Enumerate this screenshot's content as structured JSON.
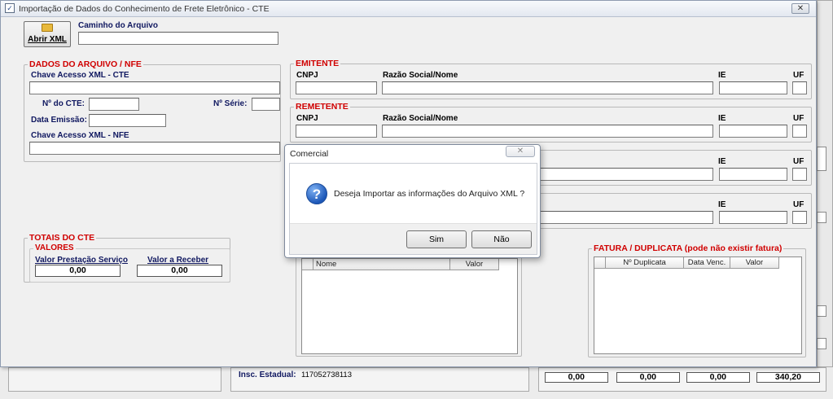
{
  "window": {
    "title": "Importação de Dados do Conhecimento de Frete Eletrônico - CTE",
    "close_label": "✕"
  },
  "toolbar": {
    "open_xml_label": "Abrir XML",
    "file_path_label": "Caminho do Arquivo",
    "file_path_value": ""
  },
  "arquivo": {
    "title": "DADOS DO ARQUIVO / NFE",
    "chave_cte_label": "Chave Acesso XML - CTE",
    "num_cte_label": "Nº do CTE:",
    "num_serie_label": "Nº Série:",
    "data_emissao_label": "Data Emissão:",
    "chave_nfe_label": "Chave Acesso XML - NFE"
  },
  "emitente": {
    "title": "EMITENTE",
    "cnpj_label": "CNPJ",
    "razao_label": "Razão Social/Nome",
    "ie_label": "IE",
    "uf_label": "UF"
  },
  "remetente": {
    "title": "REMETENTE",
    "cnpj_label": "CNPJ",
    "razao_label": "Razão Social/Nome",
    "ie_label": "IE",
    "uf_label": "UF"
  },
  "row3": {
    "ie_label": "IE",
    "uf_label": "UF"
  },
  "row4": {
    "ie_label": "IE",
    "uf_label": "UF"
  },
  "totais": {
    "title": "TOTAIS DO CTE",
    "valores_title": "VALORES",
    "prestacao_label": "Valor Prestação Serviço",
    "prestacao_value": "0,00",
    "receber_label": "Valor a Receber",
    "receber_value": "0,00"
  },
  "itens_grid": {
    "columns": [
      "Nome",
      "Valor"
    ]
  },
  "fatura": {
    "title": "FATURA / DUPLICATA (pode não existir fatura)",
    "columns": [
      "Nº Duplicata",
      "Data Venc.",
      "Valor"
    ]
  },
  "background": {
    "insc_label": "Insc. Estadual:",
    "insc_value": "117052738113",
    "totals": [
      "0,00",
      "0,00",
      "0,00",
      "340,20"
    ]
  },
  "dialog": {
    "title": "Comercial",
    "close_label": "✕",
    "message": "Deseja Importar as informações do Arquivo XML ?",
    "yes_label": "Sim",
    "no_label": "Não"
  }
}
